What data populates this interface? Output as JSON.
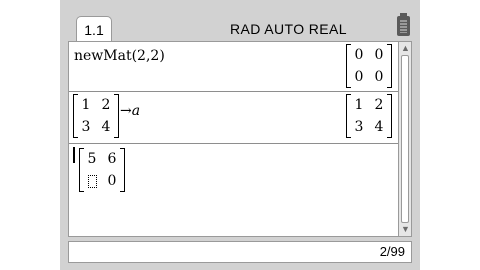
{
  "header": {
    "tab_label": "1.1",
    "mode_text": "RAD AUTO REAL",
    "battery_icon": "battery-icon"
  },
  "history": [
    {
      "input": "newMat(2,2)",
      "result": [
        "0",
        "0",
        "0",
        "0"
      ]
    },
    {
      "input_matrix": [
        "1",
        "2",
        "3",
        "4"
      ],
      "assign_arrow": "→",
      "assign_var": "a",
      "result": [
        "1",
        "2",
        "3",
        "4"
      ]
    }
  ],
  "current_entry": {
    "matrix": [
      "5",
      "6",
      "",
      "0"
    ]
  },
  "status": {
    "counter": "2/99"
  },
  "scroll": {
    "up_icon": "▲",
    "down_icon": "▼"
  }
}
